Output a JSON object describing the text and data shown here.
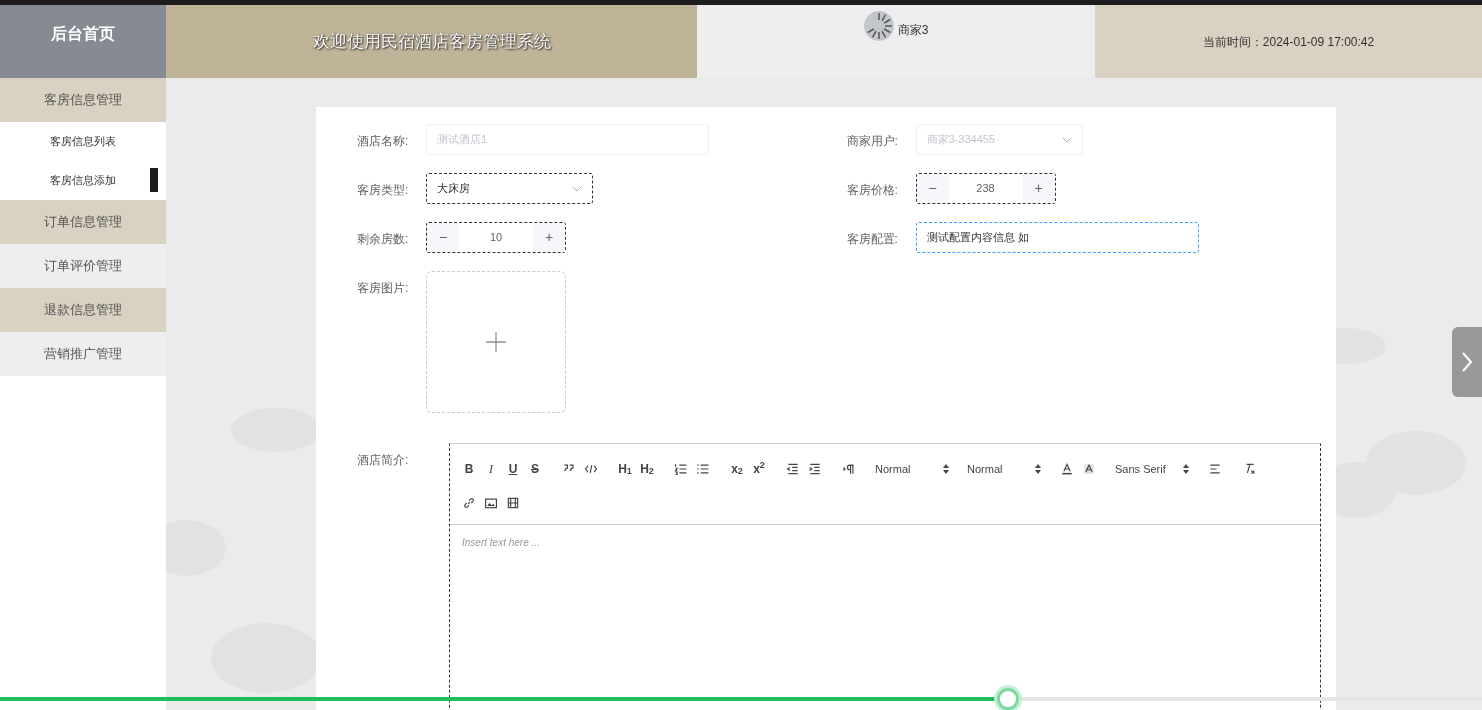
{
  "header": {
    "home": "后台首页",
    "title": "欢迎使用民宿酒店客房管理系统",
    "user": "商家3",
    "time": "当前时间：2024-01-09 17:00:42"
  },
  "sidebar": {
    "items": [
      {
        "label": "客房信息管理",
        "highlighted": true,
        "children": [
          {
            "label": "客房信息列表",
            "selected": false
          },
          {
            "label": "客房信息添加",
            "selected": true
          }
        ]
      },
      {
        "label": "订单信息管理",
        "highlighted": true
      },
      {
        "label": "订单评价管理",
        "highlighted": false
      },
      {
        "label": "退款信息管理",
        "highlighted": true
      },
      {
        "label": "营销推广管理",
        "highlighted": false
      }
    ]
  },
  "form": {
    "rows": [
      [
        {
          "kind": "text",
          "label": "酒店名称:",
          "value": "测试酒店1",
          "disabled": true
        },
        {
          "kind": "select",
          "label": "商家用户:",
          "value": "商家3-334455",
          "disabled": true
        }
      ],
      [
        {
          "kind": "select",
          "label": "客房类型:",
          "value": "大床房",
          "disabled": false
        },
        {
          "kind": "number",
          "label": "客房价格:",
          "value": "238",
          "minus": "−",
          "plus": "+",
          "disabled": false
        }
      ],
      [
        {
          "kind": "number",
          "label": "剩余房数:",
          "value": "10",
          "minus": "−",
          "plus": "+",
          "disabled": false
        },
        {
          "kind": "wide",
          "label": "客房配置:",
          "value": "测试配置内容信息 如",
          "disabled": false
        }
      ],
      [
        {
          "kind": "upload",
          "label": "客房图片:"
        }
      ]
    ],
    "editor": {
      "label": "酒店简介:",
      "placeholder": "Insert text here ...",
      "toolbar": [
        [
          {
            "kind": "glyph",
            "text": "B"
          },
          {
            "kind": "glyph",
            "text": "I"
          },
          {
            "kind": "glyph",
            "text": "U"
          },
          {
            "kind": "glyph",
            "text": "S"
          },
          {
            "kind": "icon"
          },
          {
            "kind": "icon"
          },
          {
            "kind": "glyph",
            "text": "H$_{1}$"
          },
          {
            "kind": "glyph",
            "text": "H$_{2}$"
          },
          {
            "kind": "icon"
          },
          {
            "kind": "icon"
          },
          {
            "kind": "glyph",
            "text": "x$_{2}$"
          },
          {
            "kind": "glyph",
            "text": "x$^{2}$"
          },
          {
            "kind": "icon"
          },
          {
            "kind": "icon"
          },
          {
            "kind": "icon"
          },
          {
            "kind": "picker",
            "text": "Normal"
          },
          {
            "kind": "picker",
            "text": "Normal"
          },
          {
            "kind": "icon"
          },
          {
            "kind": "icon"
          },
          {
            "kind": "picker",
            "text": "Sans Serif"
          },
          {
            "kind": "icon"
          },
          {
            "kind": "icon"
          }
        ],
        [
          {
            "kind": "icon"
          },
          {
            "kind": "icon"
          },
          {
            "kind": "icon"
          }
        ]
      ]
    }
  },
  "video_progress": {
    "level": 0.68
  }
}
